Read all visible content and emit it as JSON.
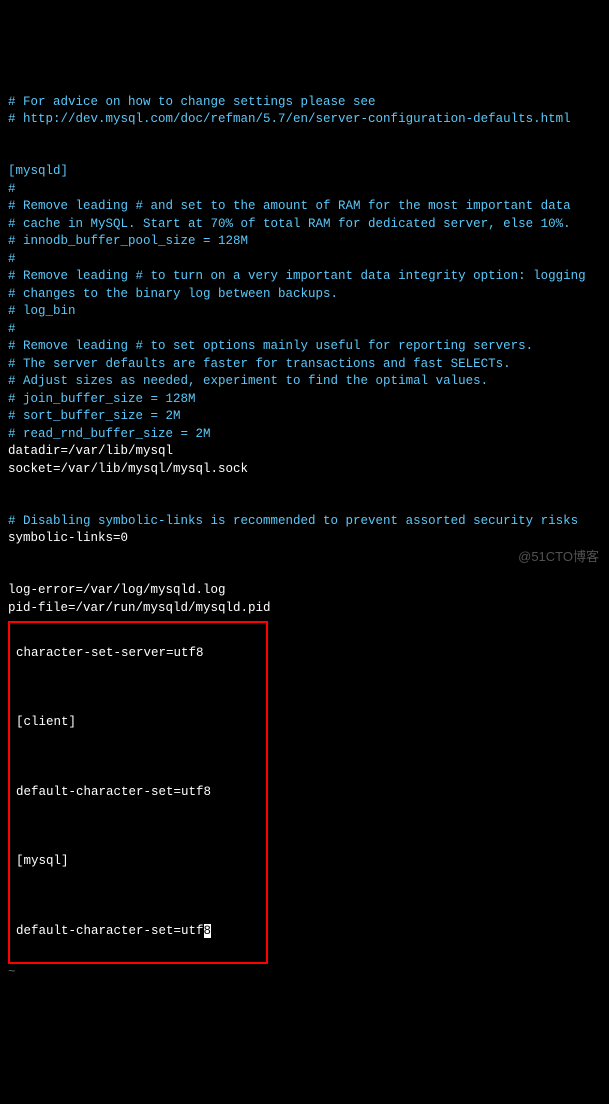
{
  "lines": {
    "c1": "# For advice on how to change settings please see",
    "c2": "# http://dev.mysql.com/doc/refman/5.7/en/server-configuration-defaults.html",
    "sec_mysqld": "[mysqld]",
    "c3": "#",
    "c4": "# Remove leading # and set to the amount of RAM for the most important data",
    "c5": "# cache in MySQL. Start at 70% of total RAM for dedicated server, else 10%.",
    "c6": "# innodb_buffer_pool_size = 128M",
    "c7": "#",
    "c8": "# Remove leading # to turn on a very important data integrity option: logging",
    "c9": "# changes to the binary log between backups.",
    "c10": "# log_bin",
    "c11": "#",
    "c12": "# Remove leading # to set options mainly useful for reporting servers.",
    "c13": "# The server defaults are faster for transactions and fast SELECTs.",
    "c14": "# Adjust sizes as needed, experiment to find the optimal values.",
    "c15": "# join_buffer_size = 128M",
    "c16": "# sort_buffer_size = 2M",
    "c17": "# read_rnd_buffer_size = 2M",
    "w1": "datadir=/var/lib/mysql",
    "w2": "socket=/var/lib/mysql/mysql.sock",
    "c18": "# Disabling symbolic-links is recommended to prevent assorted security risks",
    "w3": "symbolic-links=0",
    "w4": "log-error=/var/log/mysqld.log",
    "w5": "pid-file=/var/run/mysqld/mysqld.pid",
    "h1": "character-set-server=utf8",
    "h2": "[client]",
    "h3": "default-character-set=utf8",
    "h4": "[mysql]",
    "h5_pre": "default-character-set=utf",
    "h5_cursor": "8",
    "tilde": "~"
  },
  "watermark": "@51CTO博客"
}
